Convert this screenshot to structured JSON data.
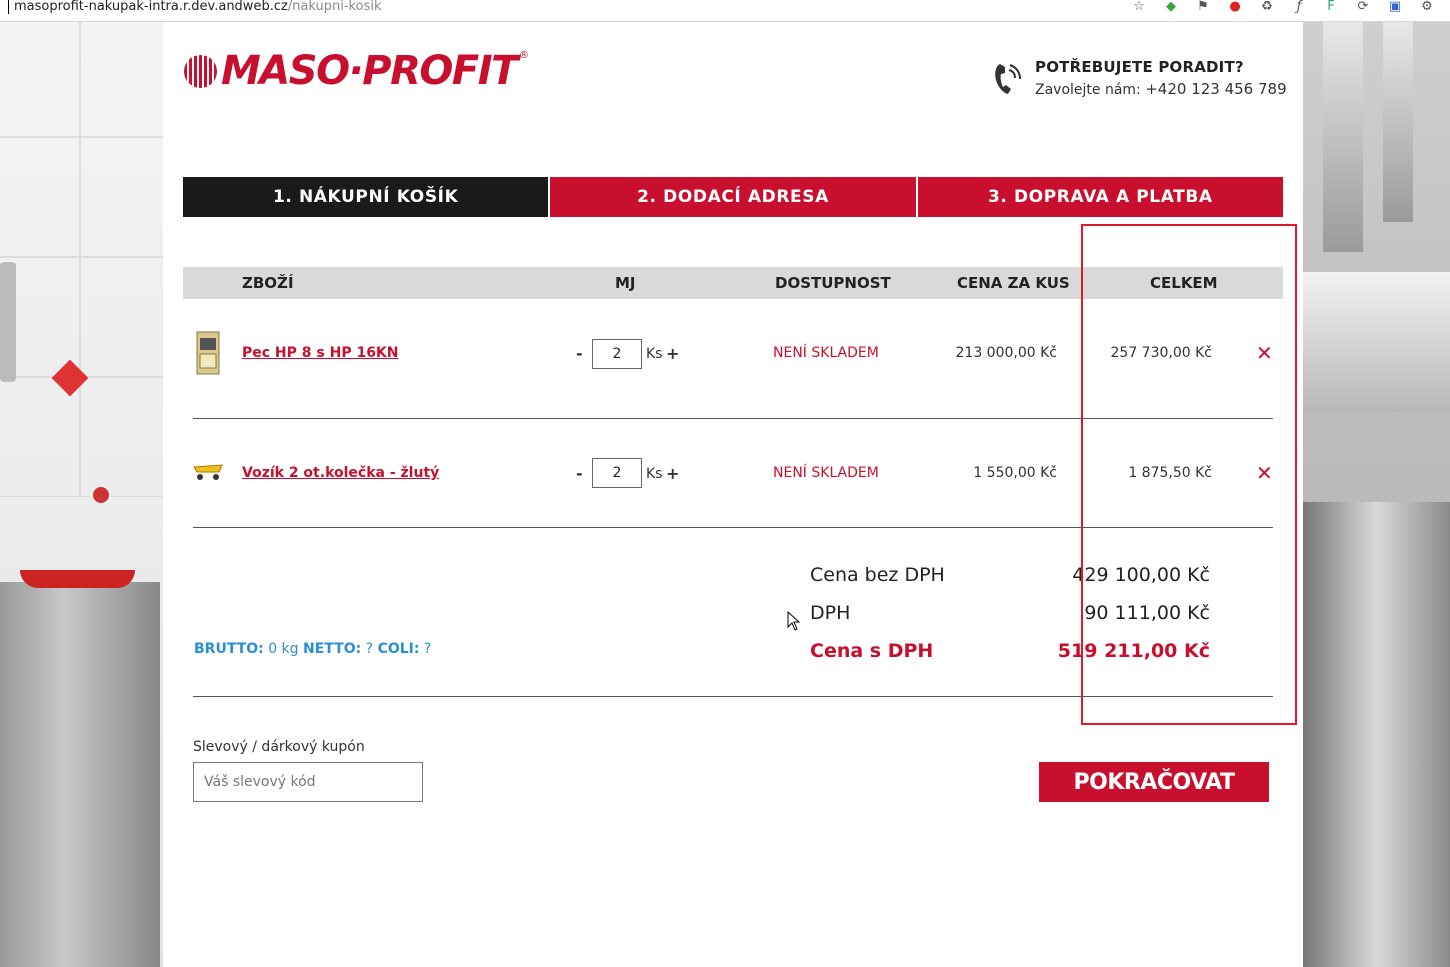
{
  "browser": {
    "url_host": "masoprofit-nakupak-intra.r.dev.andweb.cz",
    "url_path": "/nakupni-kosik"
  },
  "brand": {
    "name": "MASO·PROFIT",
    "registered": "®",
    "accent_color": "#c8102e"
  },
  "help": {
    "title": "POTŘEBUJETE PORADIT?",
    "call_text": "Zavolejte nám:",
    "phone": "+420 123 456 789",
    "icon": "phone-icon"
  },
  "steps": [
    {
      "label": "1. NÁKUPNÍ KOŠÍK",
      "active": true
    },
    {
      "label": "2. DODACÍ ADRESA",
      "active": false
    },
    {
      "label": "3. DOPRAVA A PLATBA",
      "active": false
    }
  ],
  "table": {
    "headers": {
      "product": "ZBOŽÍ",
      "unit": "MJ",
      "availability": "DOSTUPNOST",
      "unit_price": "CENA ZA KUS",
      "total": "CELKEM"
    },
    "rows": [
      {
        "name": "Pec HP 8 s HP 16KN",
        "quantity": "2",
        "unit": "Ks",
        "availability": "NENÍ SKLADEM",
        "unit_price": "213 000,00 Kč",
        "total": "257 730,00 Kč",
        "image_icon": "oven-icon"
      },
      {
        "name": "Vozík 2 ot.kolečka - žlutý",
        "quantity": "2",
        "unit": "Ks",
        "availability": "NENÍ SKLADEM",
        "unit_price": "1 550,00 Kč",
        "total": "1 875,50 Kč",
        "image_icon": "cart-dolly-icon"
      }
    ],
    "minus": "-",
    "plus": "+",
    "remove": "✕"
  },
  "totals": {
    "without_vat_label": "Cena bez DPH",
    "without_vat_value": "429 100,00 Kč",
    "vat_label": "DPH",
    "vat_value": "90 111,00 Kč",
    "with_vat_label": "Cena s DPH",
    "with_vat_value": "519 211,00 Kč"
  },
  "weights": {
    "brutto_label": "BRUTTO:",
    "brutto_value": "0 kg",
    "netto_label": "NETTO:",
    "netto_value": "?",
    "coli_label": "COLI:",
    "coli_value": "?"
  },
  "coupon": {
    "label": "Slevový / dárkový kupón",
    "placeholder": "Váš slevový kód",
    "value": ""
  },
  "continue_label": "POKRAČOVAT"
}
